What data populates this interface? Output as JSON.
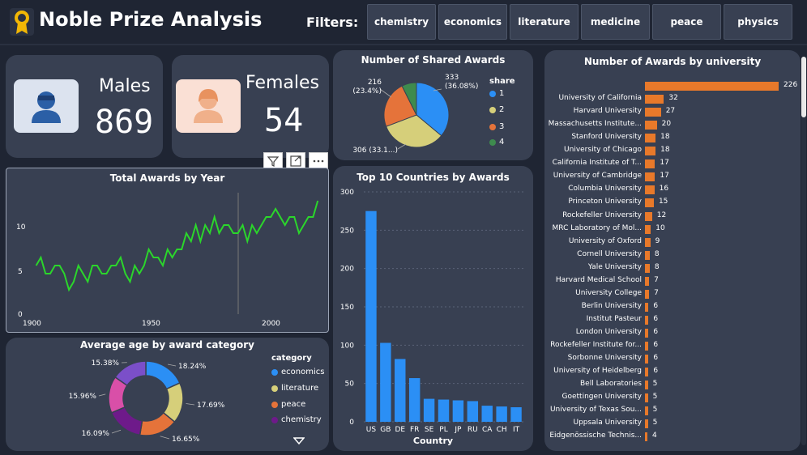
{
  "header": {
    "title": "Noble Prize Analysis",
    "filters_label": "Filters:",
    "filters": [
      "chemistry",
      "economics",
      "literature",
      "medicine",
      "peace",
      "physics"
    ]
  },
  "kpi": {
    "males_label": "Males",
    "males_value": "869",
    "females_label": "Females",
    "females_value": "54"
  },
  "shared": {
    "title": "Number of Shared Awards",
    "legend_title": "share",
    "slices": [
      {
        "label": "1",
        "value": 333,
        "text": "333 (36.08%)",
        "color": "#2b8ff5"
      },
      {
        "label": "2",
        "value": 306,
        "text": "306 (33.1...)",
        "color": "#d6cf7a"
      },
      {
        "label": "3",
        "value": 216,
        "text": "216 (23.4%)",
        "color": "#e5733a"
      },
      {
        "label": "4",
        "value": 68,
        "text": "",
        "color": "#3e8b4e"
      }
    ]
  },
  "universities": {
    "title": "Number of Awards by university",
    "rows": [
      {
        "name": "",
        "value": 226
      },
      {
        "name": "University of California",
        "value": 32
      },
      {
        "name": "Harvard University",
        "value": 27
      },
      {
        "name": "Massachusetts Institute...",
        "value": 20
      },
      {
        "name": "Stanford University",
        "value": 18
      },
      {
        "name": "University of Chicago",
        "value": 18
      },
      {
        "name": "California Institute of T...",
        "value": 17
      },
      {
        "name": "University of Cambridge",
        "value": 17
      },
      {
        "name": "Columbia University",
        "value": 16
      },
      {
        "name": "Princeton University",
        "value": 15
      },
      {
        "name": "Rockefeller University",
        "value": 12
      },
      {
        "name": "MRC Laboratory of Mol...",
        "value": 10
      },
      {
        "name": "University of Oxford",
        "value": 9
      },
      {
        "name": "Cornell University",
        "value": 8
      },
      {
        "name": "Yale University",
        "value": 8
      },
      {
        "name": "Harvard Medical School",
        "value": 7
      },
      {
        "name": "University College",
        "value": 7
      },
      {
        "name": "Berlin University",
        "value": 6
      },
      {
        "name": "Institut Pasteur",
        "value": 6
      },
      {
        "name": "London University",
        "value": 6
      },
      {
        "name": "Rockefeller Institute for...",
        "value": 6
      },
      {
        "name": "Sorbonne University",
        "value": 6
      },
      {
        "name": "University of Heidelberg",
        "value": 6
      },
      {
        "name": "Bell Laboratories",
        "value": 5
      },
      {
        "name": "Goettingen University",
        "value": 5
      },
      {
        "name": "University of Texas Sou...",
        "value": 5
      },
      {
        "name": "Uppsala University",
        "value": 5
      },
      {
        "name": "Eidgenössische Technis...",
        "value": 4
      }
    ]
  },
  "year_chart": {
    "title": "Total Awards by Year",
    "x_ticks": [
      "1900",
      "1950",
      "2000"
    ],
    "y_ticks": [
      "0",
      "5",
      "10"
    ],
    "color": "#2bd62b"
  },
  "countries": {
    "title": "Top 10 Countries by Awards",
    "xlabel": "Country",
    "y_ticks": [
      "0",
      "50",
      "100",
      "150",
      "200",
      "250",
      "300"
    ]
  },
  "age": {
    "title": "Average age by award category",
    "legend_title": "category",
    "legend": [
      {
        "label": "economics",
        "color": "#2b8ff5"
      },
      {
        "label": "literature",
        "color": "#d6cf7a"
      },
      {
        "label": "peace",
        "color": "#e5733a"
      },
      {
        "label": "chemistry",
        "color": "#6e1a8a"
      }
    ]
  },
  "chart_data": [
    {
      "type": "line",
      "title": "Total Awards by Year",
      "xlim": [
        1897,
        2023
      ],
      "ylim": [
        0,
        15
      ],
      "x": [
        1901,
        1903,
        1905,
        1907,
        1909,
        1911,
        1913,
        1915,
        1917,
        1919,
        1921,
        1923,
        1925,
        1927,
        1929,
        1931,
        1933,
        1935,
        1937,
        1939,
        1941,
        1943,
        1945,
        1947,
        1949,
        1951,
        1953,
        1955,
        1957,
        1959,
        1961,
        1963,
        1965,
        1967,
        1969,
        1971,
        1973,
        1975,
        1977,
        1979,
        1981,
        1983,
        1985,
        1987,
        1989,
        1991,
        1993,
        1995,
        1997,
        1999,
        2001,
        2003,
        2005,
        2007,
        2009,
        2011,
        2013,
        2015,
        2017,
        2019,
        2021
      ],
      "y": [
        6,
        7,
        5,
        5,
        6,
        6,
        5,
        3,
        4,
        6,
        5,
        4,
        6,
        6,
        5,
        5,
        6,
        6,
        7,
        5,
        4,
        6,
        5,
        6,
        8,
        7,
        7,
        6,
        8,
        7,
        8,
        8,
        10,
        9,
        11,
        9,
        11,
        10,
        12,
        10,
        11,
        11,
        10,
        10,
        11,
        9,
        11,
        10,
        11,
        12,
        12,
        13,
        12,
        11,
        12,
        12,
        10,
        11,
        12,
        12,
        14
      ]
    },
    {
      "type": "bar",
      "title": "Top 10 Countries by Awards",
      "xlabel": "Country",
      "categories": [
        "US",
        "GB",
        "DE",
        "FR",
        "SE",
        "PL",
        "JP",
        "RU",
        "CA",
        "CH",
        "IT"
      ],
      "values": [
        275,
        103,
        82,
        57,
        30,
        29,
        28,
        27,
        21,
        20,
        19
      ],
      "ylim": [
        0,
        300
      ]
    },
    {
      "type": "pie",
      "title": "Number of Shared Awards",
      "categories": [
        "1",
        "2",
        "3",
        "4"
      ],
      "values": [
        333,
        306,
        216,
        68
      ]
    },
    {
      "type": "pie",
      "title": "Average age by award category",
      "categories": [
        "economics",
        "literature",
        "peace",
        "chemistry",
        "",
        "",
        ""
      ],
      "values": [
        18.24,
        17.69,
        16.65,
        16.09,
        15.96,
        15.38
      ]
    },
    {
      "type": "bar",
      "title": "Number of Awards by university",
      "categories": [
        "",
        "University of California",
        "Harvard University",
        "Massachusetts Institute...",
        "Stanford University",
        "University of Chicago",
        "California Institute of T...",
        "University of Cambridge",
        "Columbia University",
        "Princeton University",
        "Rockefeller University",
        "MRC Laboratory of Mol...",
        "University of Oxford",
        "Cornell University",
        "Yale University",
        "Harvard Medical School",
        "University College",
        "Berlin University",
        "Institut Pasteur",
        "London University",
        "Rockefeller Institute for...",
        "Sorbonne University",
        "University of Heidelberg",
        "Bell Laboratories",
        "Goettingen University",
        "University of Texas Sou...",
        "Uppsala University",
        "Eidgenössische Technis..."
      ],
      "values": [
        226,
        32,
        27,
        20,
        18,
        18,
        17,
        17,
        16,
        15,
        12,
        10,
        9,
        8,
        8,
        7,
        7,
        6,
        6,
        6,
        6,
        6,
        6,
        5,
        5,
        5,
        5,
        4
      ]
    }
  ],
  "age_labels": [
    "18.24%",
    "17.69%",
    "16.65%",
    "16.09%",
    "15.96%",
    "15.38%"
  ]
}
